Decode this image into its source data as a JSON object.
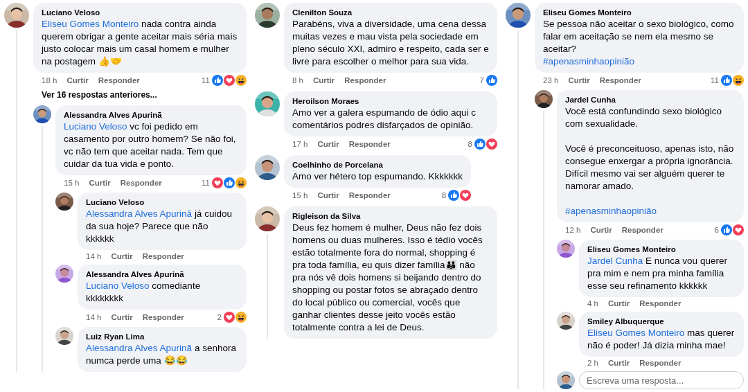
{
  "columns": [
    {
      "comments": [
        {
          "author": "Luciano Veloso",
          "mention": "Eliseu Gomes Monteiro",
          "paragraphs": [
            "nada contra ainda querem obrigar a gente aceitar mais séria mais justo colocar mais um casal homem e mulher na postagem 👍🤝"
          ],
          "time": "18 h",
          "like": "Curtir",
          "reply": "Responder",
          "reactions": {
            "count": "11",
            "icons": [
              {
                "kind": "like"
              },
              {
                "kind": "love"
              },
              {
                "kind": "haha"
              }
            ]
          },
          "more_replies": "Ver 16 respostas anteriores...",
          "replies": [
            {
              "author": "Alessandra Alves Apurinã",
              "mention": "Luciano Veloso",
              "paragraphs": [
                "vc foi pedido em casamento por outro homem? Se não foi, vc não tem que aceitar nada. Tem que cuidar da tua vida e ponto."
              ],
              "time": "15 h",
              "like": "Curtir",
              "reply": "Responder",
              "reactions": {
                "count": "11",
                "icons": [
                  {
                    "kind": "love"
                  },
                  {
                    "kind": "like"
                  },
                  {
                    "kind": "haha"
                  }
                ]
              },
              "replies": [
                {
                  "author": "Luciano Veloso",
                  "mention": "Alessandra Alves Apurinã",
                  "paragraphs": [
                    "já cuidou da sua hoje? Parece que não kkkkkk"
                  ],
                  "time": "14 h",
                  "like": "Curtir",
                  "reply": "Responder"
                },
                {
                  "author": "Alessandra Alves Apurinã",
                  "mention": "Luciano Veloso",
                  "paragraphs": [
                    "comediante kkkkkkkk"
                  ],
                  "time": "14 h",
                  "like": "Curtir",
                  "reply": "Responder",
                  "reactions": {
                    "count": "2",
                    "icons": [
                      {
                        "kind": "love"
                      },
                      {
                        "kind": "haha"
                      }
                    ]
                  }
                },
                {
                  "author": "Luiz Ryan Lima",
                  "mention": "Alessandra Alves Apurinã",
                  "paragraphs": [
                    "a senhora numca perde uma 😂😂"
                  ]
                }
              ]
            }
          ]
        }
      ]
    },
    {
      "comments": [
        {
          "author": "Clenilton Souza",
          "paragraphs": [
            "Parabéns, viva a diversidade, uma cena dessa muitas vezes e mau vista pela sociedade em pleno século XXI, admiro e respeito, cada ser e livre para escolher o melhor para sua vida."
          ],
          "time": "8 h",
          "like": "Curtir",
          "reply": "Responder",
          "reactions": {
            "count": "7",
            "icons": [
              {
                "kind": "like"
              }
            ]
          }
        },
        {
          "author": "Heroilson Moraes",
          "paragraphs": [
            "Amo ver a galera espumando de ódio aqui c comentários podres disfarçados de opinião."
          ],
          "time": "17 h",
          "like": "Curtir",
          "reply": "Responder",
          "reactions": {
            "count": "8",
            "icons": [
              {
                "kind": "like"
              },
              {
                "kind": "love"
              }
            ]
          }
        },
        {
          "author": "Coelhinho de Porcelana",
          "paragraphs": [
            "Amo ver hétero top espumando. Kkkkkkk"
          ],
          "time": "15 h",
          "like": "Curtir",
          "reply": "Responder",
          "reactions": {
            "count": "8",
            "icons": [
              {
                "kind": "like"
              },
              {
                "kind": "love"
              }
            ]
          }
        },
        {
          "author": "Rigleison da Silva",
          "paragraphs": [
            "Deus fez homem é mulher, Deus não fez dois homens ou duas mulheres. Isso é tédio vocês estão totalmente fora do normal, shopping é pra toda família, eu quis dizer família👪 não pra nós vê dois homens si beijando dentro do shopping ou postar fotos se abraçado dentro do local público ou comercial, vocês que ganhar clientes desse jeito vocês estão totalmente contra a lei de Deus."
          ],
          "thread": true
        }
      ]
    },
    {
      "comments": [
        {
          "author": "Eliseu Gomes Monteiro",
          "paragraphs": [
            "Se pessoa não aceitar o sexo biológico, como falar em aceitação se nem ela mesmo se aceitar?"
          ],
          "hashtag": "#apenasminhaopinião",
          "time": "23 h",
          "like": "Curtir",
          "reply": "Responder",
          "reactions": {
            "count": "11",
            "icons": [
              {
                "kind": "like"
              },
              {
                "kind": "haha"
              }
            ]
          },
          "replies": [
            {
              "author": "Jardel Cunha",
              "paragraphs": [
                "Você está confundindo sexo biológico com sexualidade.",
                "Você é preconceituoso, apenas isto, não consegue enxergar a própria ignorância. Difícil mesmo vai ser alguém querer te namorar amado."
              ],
              "hashtag": "#apenasminhaopinião",
              "time": "12 h",
              "like": "Curtir",
              "reply": "Responder",
              "reactions": {
                "count": "6",
                "icons": [
                  {
                    "kind": "like"
                  },
                  {
                    "kind": "love"
                  }
                ]
              },
              "replies": [
                {
                  "author": "Eliseu Gomes Monteiro",
                  "mention": "Jardel Cunha",
                  "paragraphs": [
                    "E nunca vou querer pra mim e nem pra minha família esse seu refinamento kkkkkk"
                  ],
                  "time": "4 h",
                  "like": "Curtir",
                  "reply": "Responder"
                },
                {
                  "author": "Smiley Albuquerque",
                  "mention": "Eliseu Gomes Monteiro",
                  "paragraphs": [
                    "mas querer não é poder! Já dizia minha mae!"
                  ],
                  "time": "2 h",
                  "like": "Curtir",
                  "reply": "Responder"
                }
              ],
              "reply_field": {
                "placeholder": "Escreva uma resposta..."
              }
            }
          ]
        }
      ]
    }
  ]
}
